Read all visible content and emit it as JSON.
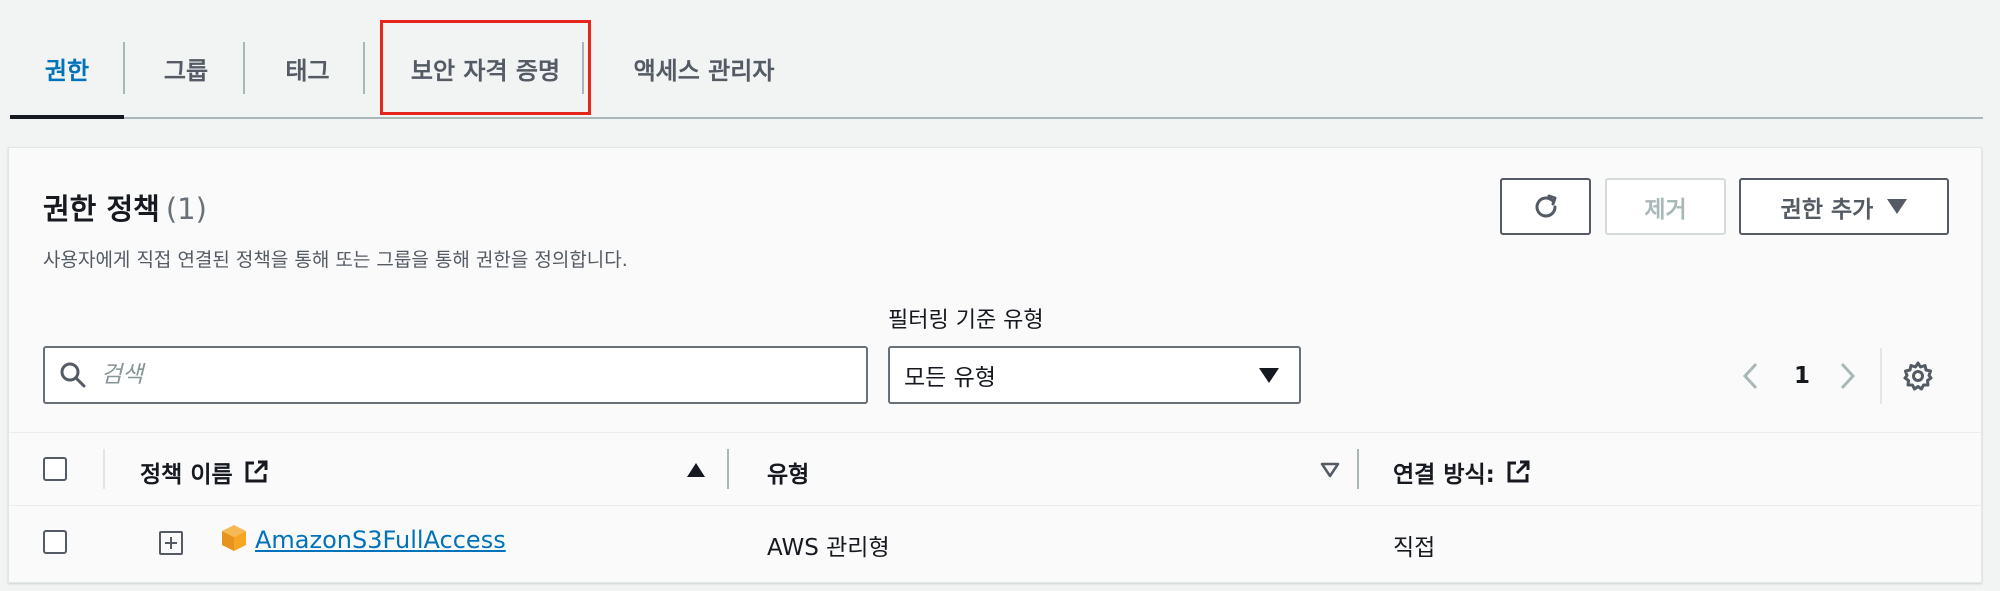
{
  "tabs": [
    {
      "label": "권한",
      "active": true
    },
    {
      "label": "그룹",
      "active": false
    },
    {
      "label": "태그",
      "active": false
    },
    {
      "label": "보안 자격 증명",
      "active": false,
      "highlighted": true
    },
    {
      "label": "액세스 관리자",
      "active": false
    }
  ],
  "panel": {
    "title": "권한 정책",
    "count": "(1)",
    "description": "사용자에게 직접 연결된 정책을 통해 또는 그룹을 통해 권한을 정의합니다.",
    "buttons": {
      "refresh_icon": "refresh-icon",
      "remove_label": "제거",
      "add_label": "권한 추가"
    },
    "search": {
      "placeholder": "검색",
      "value": ""
    },
    "filter": {
      "label": "필터링 기준 유형",
      "selected": "모든 유형"
    },
    "pagination": {
      "current_page": "1"
    }
  },
  "table": {
    "columns": [
      {
        "label": "정책 이름",
        "sort": "ascending",
        "external_link": true
      },
      {
        "label": "유형",
        "sort": "none"
      },
      {
        "label": "연결 방식:",
        "external_link": true
      }
    ],
    "rows": [
      {
        "policy_name": "AmazonS3FullAccess",
        "type": "AWS 관리형",
        "attached_via": "직접",
        "icon": "aws-managed-policy-icon"
      }
    ]
  },
  "colors": {
    "accent": "#0073bb",
    "highlight_border": "#e5241b",
    "text": "#16191f",
    "muted": "#545b64",
    "aws_orange": "#f5a623"
  }
}
